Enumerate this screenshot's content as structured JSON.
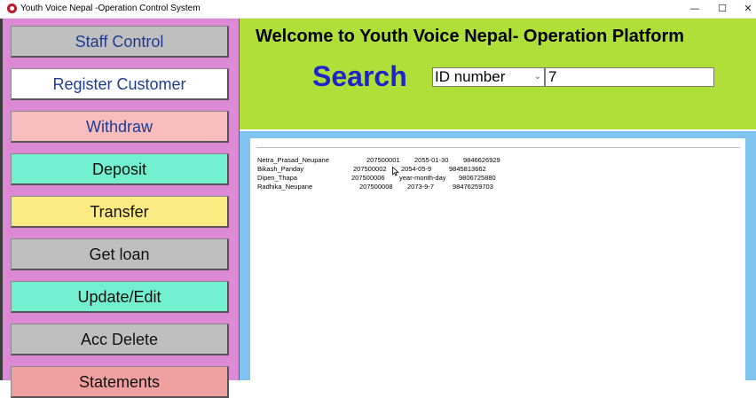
{
  "window": {
    "title": "Youth Voice Nepal -Operation Control System",
    "controls": {
      "minimize": "—",
      "maximize": "☐",
      "close": "✕"
    }
  },
  "sidebar": {
    "items": [
      {
        "label": "Staff Control",
        "bg": "#bfbfbf",
        "fg": "#1f3b8f"
      },
      {
        "label": "Register Customer",
        "bg": "#ffffff",
        "fg": "#1f3b8f"
      },
      {
        "label": "Withdraw",
        "bg": "#f9bcbc",
        "fg": "#1f3b8f"
      },
      {
        "label": "Deposit",
        "bg": "#72f0d0",
        "fg": "#111111"
      },
      {
        "label": "Transfer",
        "bg": "#fbeb82",
        "fg": "#111111"
      },
      {
        "label": "Get loan",
        "bg": "#bfbfbf",
        "fg": "#111111"
      },
      {
        "label": "Update/Edit",
        "bg": "#72f0d0",
        "fg": "#111111"
      },
      {
        "label": "Acc Delete",
        "bg": "#bfbfbf",
        "fg": "#111111"
      },
      {
        "label": "Statements",
        "bg": "#f0a0a0",
        "fg": "#111111"
      }
    ]
  },
  "header": {
    "welcome": "Welcome to Youth Voice Nepal- Operation Platform",
    "search_label": "Search",
    "search_by": {
      "selected": "ID number"
    },
    "search_value": "7",
    "colors": {
      "header_bg": "#b1df39",
      "search_label": "#1d24c8"
    }
  },
  "results": {
    "rows": [
      {
        "name": "Netra_Prasad_Neupane",
        "id": "207500001",
        "date": "2055-01-30",
        "phone": "9846626929"
      },
      {
        "name": "Bikash_Panday",
        "id": "207500002",
        "date": "2054-05-9",
        "phone": "9845813662"
      },
      {
        "name": "Dipen_Thapa",
        "id": "207500006",
        "date": "year-month-day",
        "phone": "9806725880"
      },
      {
        "name": "Radhika_Neupane",
        "id": "207500008",
        "date": "2073-9-7",
        "phone": "98476259703"
      }
    ]
  }
}
